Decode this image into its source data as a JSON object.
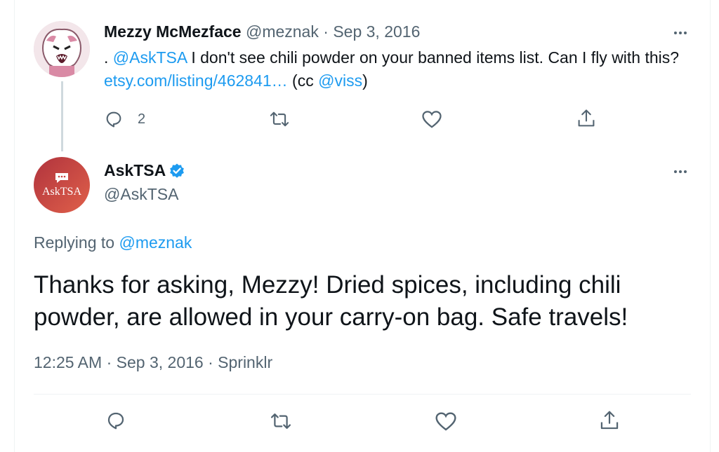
{
  "reply_tweet": {
    "display_name": "Mezzy McMezface",
    "handle": "@meznak",
    "separator": "·",
    "date": "Sep 3, 2016",
    "text_prefix": ". ",
    "mention_1": "@AskTSA",
    "text_1": " I don't see chili powder on your banned items list. Can I fly with this? ",
    "link": "etsy.com/listing/462841…",
    "text_2": " (cc ",
    "mention_2": "@viss",
    "text_3": ")",
    "reply_count": "2"
  },
  "main_tweet": {
    "display_name": "AskTSA",
    "verified": true,
    "handle": "@AskTSA",
    "avatar_text": "AskTSA",
    "replying_to_label": "Replying to ",
    "replying_to_handle": "@meznak",
    "text": "Thanks for asking, Mezzy! Dried spices, including chili powder, are allowed in your carry-on bag. Safe travels!",
    "time": "12:25 AM",
    "separator": "·",
    "date": "Sep 3, 2016",
    "source": "Sprinklr"
  },
  "colors": {
    "accent": "#1d9bf0",
    "text": "#0f1419",
    "muted": "#536471",
    "tsa_avatar": "#c9403f"
  },
  "icons": [
    "reply-icon",
    "retweet-icon",
    "like-icon",
    "share-icon",
    "more-icon",
    "verified-badge-icon"
  ]
}
